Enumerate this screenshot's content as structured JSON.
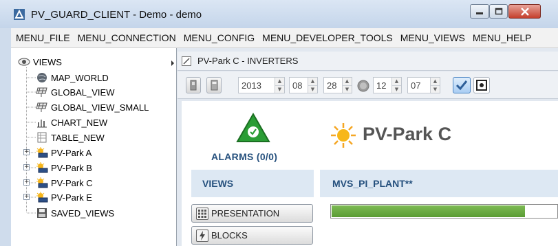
{
  "window": {
    "title": "PV_GUARD_CLIENT - Demo - demo",
    "controls": {
      "minimize": "─",
      "maximize": "□",
      "close": "✕"
    }
  },
  "menu": [
    "MENU_FILE",
    "MENU_CONNECTION",
    "MENU_CONFIG",
    "MENU_DEVELOPER_TOOLS",
    "MENU_VIEWS",
    "MENU_HELP"
  ],
  "tree": {
    "root": {
      "label": "VIEWS",
      "icon": "eye-icon"
    },
    "items": [
      {
        "label": "MAP_WORLD",
        "icon": "globe-icon",
        "expandable": false
      },
      {
        "label": "GLOBAL_VIEW",
        "icon": "solar-panel-icon",
        "expandable": false
      },
      {
        "label": "GLOBAL_VIEW_SMALL",
        "icon": "solar-panel-icon",
        "expandable": false
      },
      {
        "label": "CHART_NEW",
        "icon": "chart-icon",
        "expandable": false
      },
      {
        "label": "TABLE_NEW",
        "icon": "table-icon",
        "expandable": false
      },
      {
        "label": "PV-Park A",
        "icon": "sun-panel-icon",
        "expandable": true
      },
      {
        "label": "PV-Park B",
        "icon": "sun-panel-icon",
        "expandable": true
      },
      {
        "label": "PV-Park C",
        "icon": "sun-panel-icon",
        "expandable": true
      },
      {
        "label": "PV-Park E",
        "icon": "sun-panel-icon",
        "expandable": true
      },
      {
        "label": "SAVED_VIEWS",
        "icon": "floppy-disk-icon",
        "expandable": false
      }
    ],
    "expander_symbol": "+"
  },
  "tab": {
    "title": "PV-Park C - INVERTERS",
    "icon": "edit-icon"
  },
  "toolbar": {
    "date": {
      "year": "2013",
      "month": "08",
      "day": "28"
    },
    "time": {
      "hour": "12",
      "minute": "07"
    },
    "spin_up": "▲",
    "spin_down": "▼",
    "icons": [
      "phone-device-icon",
      "calculator-icon",
      "clock-icon",
      "check-toggle-icon",
      "settings-toggle-icon"
    ]
  },
  "content": {
    "alarms": "ALARMS (0/0)",
    "plant_name": "PV-Park C",
    "views_header": "VIEWS",
    "plant_header": "MVS_PI_PLANT**",
    "buttons": [
      {
        "label": "PRESENTATION",
        "icon": "grid-icon"
      },
      {
        "label": "BLOCKS",
        "icon": "lightning-icon"
      }
    ],
    "progress": 0.86,
    "colors": {
      "accent": "#25507d",
      "progress": "#6aaa41",
      "alarm_ok": "#2a9d35"
    }
  }
}
